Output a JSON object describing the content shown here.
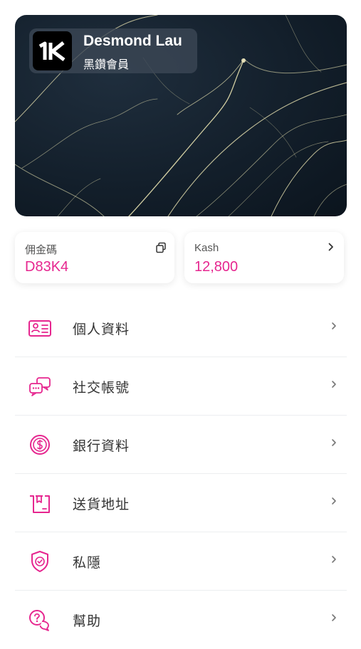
{
  "member_card": {
    "logo_text": "1K",
    "name": "Desmond Lau",
    "tier": "黑鑽會員"
  },
  "commission": {
    "label": "佣金碼",
    "value": "D83K4",
    "icon": "copy-icon"
  },
  "kash": {
    "label": "Kash",
    "value": "12,800",
    "icon": "chevron-right-icon"
  },
  "menu": [
    {
      "label": "個人資料",
      "icon": "id-card-icon"
    },
    {
      "label": "社交帳號",
      "icon": "chat-bubbles-icon"
    },
    {
      "label": "銀行資料",
      "icon": "dollar-coin-icon"
    },
    {
      "label": "送貨地址",
      "icon": "package-icon"
    },
    {
      "label": "私隱",
      "icon": "shield-check-icon"
    },
    {
      "label": "幫助",
      "icon": "help-chat-icon"
    }
  ],
  "colors": {
    "accent": "#e6268f",
    "card_background": "#131f2b",
    "card_veins": "#e8e2b0",
    "text": "#333333",
    "divider": "#eceef0"
  }
}
